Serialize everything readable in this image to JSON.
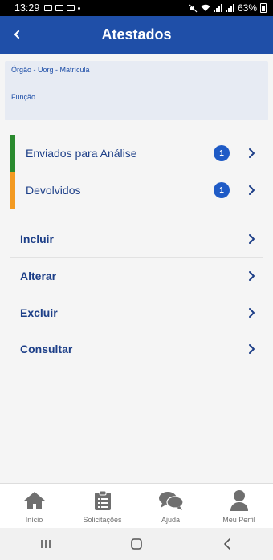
{
  "status_bar": {
    "time": "13:29",
    "battery": "63%"
  },
  "header": {
    "title": "Atestados"
  },
  "info": {
    "line1": "Órgão - Uorg - Matrícula",
    "line2": "Função"
  },
  "status_list": [
    {
      "label": "Enviados para Análise",
      "count": "1",
      "color": "#2a8a2e"
    },
    {
      "label": "Devolvidos",
      "count": "1",
      "color": "#f39a22"
    }
  ],
  "menu": [
    {
      "label": "Incluir"
    },
    {
      "label": "Alterar"
    },
    {
      "label": "Excluir"
    },
    {
      "label": "Consultar"
    }
  ],
  "bottom_nav": [
    {
      "label": "Início",
      "icon": "home-icon"
    },
    {
      "label": "Solicitações",
      "icon": "clipboard-icon"
    },
    {
      "label": "Ajuda",
      "icon": "chat-bubbles-icon"
    },
    {
      "label": "Meu Perfil",
      "icon": "person-icon"
    }
  ],
  "colors": {
    "primary": "#1f4fa8",
    "text": "#1d3f88",
    "badge": "#1f5bc6"
  }
}
